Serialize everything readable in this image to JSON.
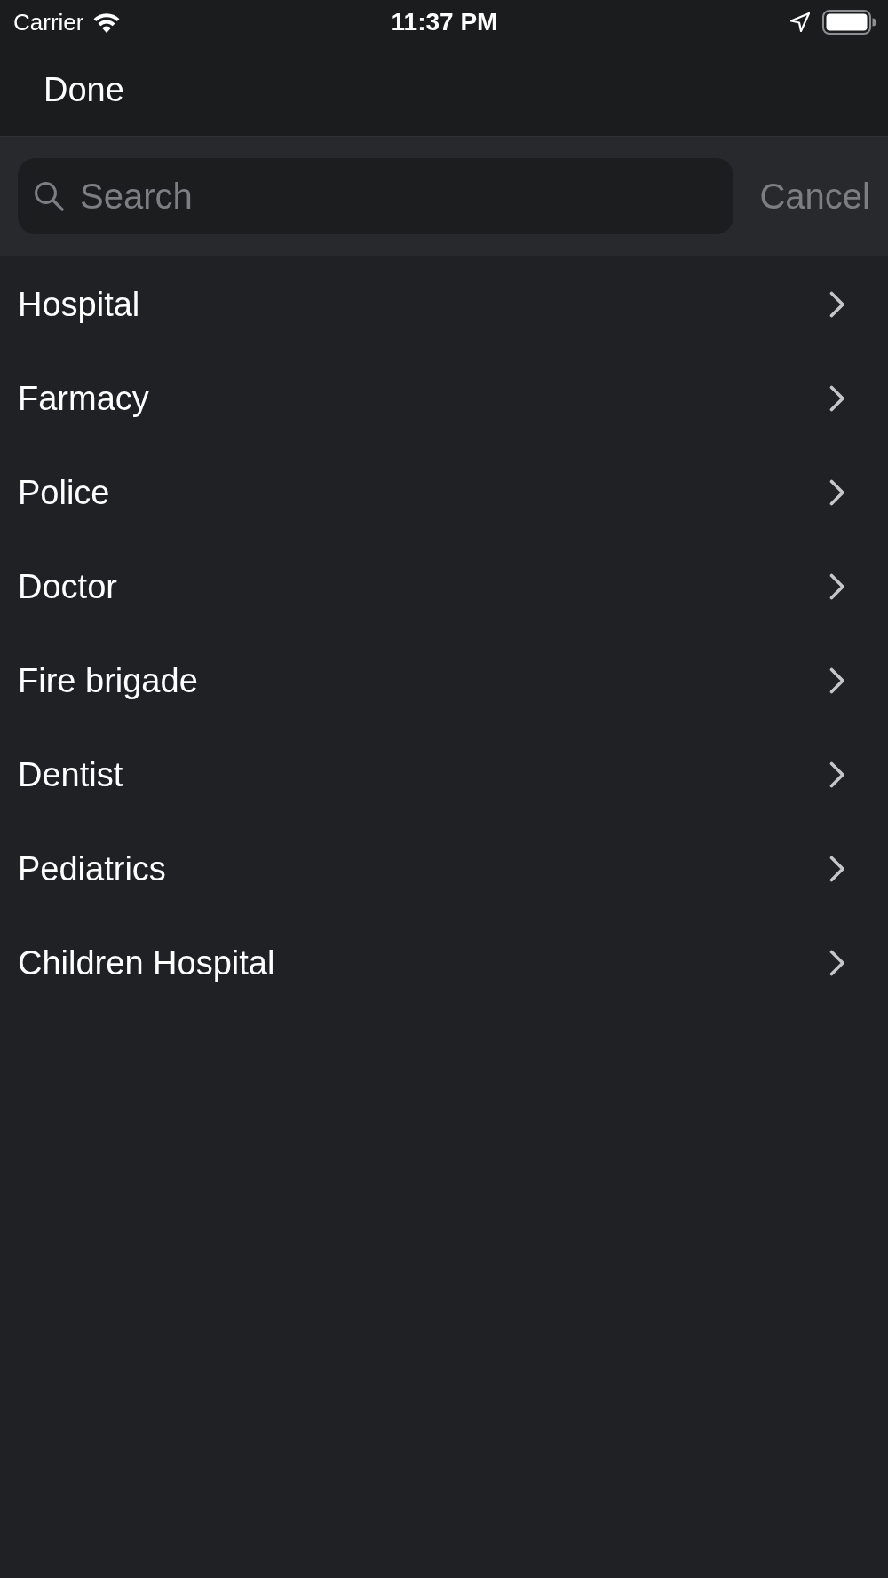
{
  "status_bar": {
    "carrier": "Carrier",
    "time": "11:37 PM"
  },
  "nav_bar": {
    "done_button": "Done"
  },
  "search": {
    "placeholder": "Search",
    "cancel_button": "Cancel"
  },
  "list": {
    "items": [
      {
        "label": "Hospital"
      },
      {
        "label": "Farmacy"
      },
      {
        "label": "Police"
      },
      {
        "label": "Doctor"
      },
      {
        "label": "Fire brigade"
      },
      {
        "label": "Dentist"
      },
      {
        "label": "Pediatrics"
      },
      {
        "label": "Children Hospital"
      }
    ]
  }
}
